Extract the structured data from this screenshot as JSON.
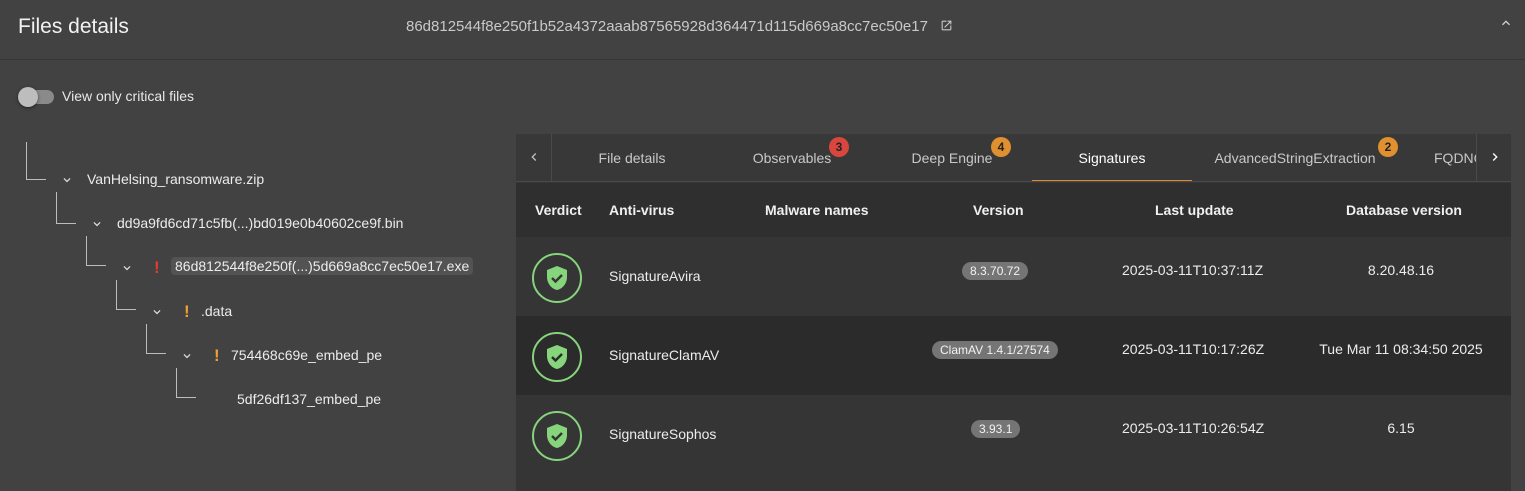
{
  "header": {
    "title": "Files details",
    "hash": "86d812544f8e250f1b52a4372aaab87565928d364471d115d669a8cc7ec50e17"
  },
  "toggle": {
    "label": "View only critical files",
    "checked": false
  },
  "tree": [
    {
      "name": "VanHelsing_ransomware.zip",
      "mark": ""
    },
    {
      "name": "dd9a9fd6cd71c5fb(...)bd019e0b40602ce9f.bin",
      "mark": ""
    },
    {
      "name": "86d812544f8e250f(...)5d669a8cc7ec50e17.exe",
      "mark": "!",
      "mark_color": "#e53935",
      "selected": true
    },
    {
      "name": ".data",
      "mark": "!",
      "mark_color": "#f0a030"
    },
    {
      "name": "754468c69e_embed_pe",
      "mark": "!",
      "mark_color": "#f0a030"
    },
    {
      "name": "5df26df137_embed_pe",
      "mark": ""
    }
  ],
  "tabs": [
    {
      "label": "File details"
    },
    {
      "label": "Observables",
      "badge": "3",
      "badge_color": "#d9463e"
    },
    {
      "label": "Deep Engine",
      "badge": "4",
      "badge_color": "#e0902e"
    },
    {
      "label": "Signatures",
      "active": true
    },
    {
      "label": "AdvancedStringExtraction",
      "badge": "2",
      "badge_color": "#e0902e"
    },
    {
      "label": "FQDNC"
    }
  ],
  "table": {
    "columns": [
      "Verdict",
      "Anti-virus",
      "Malware names",
      "Version",
      "Last update",
      "Database version"
    ],
    "rows": [
      {
        "verdict": "clean",
        "antivirus": "SignatureAvira",
        "malware": "",
        "version": "8.3.70.72",
        "last_update": "2025-03-11T10:37:11Z",
        "db_version": "8.20.48.16"
      },
      {
        "verdict": "clean",
        "antivirus": "SignatureClamAV",
        "malware": "",
        "version": "ClamAV 1.4.1/27574",
        "last_update": "2025-03-11T10:17:26Z",
        "db_version": "Tue Mar 11 08:34:50 2025"
      },
      {
        "verdict": "clean",
        "antivirus": "SignatureSophos",
        "malware": "",
        "version": "3.93.1",
        "last_update": "2025-03-11T10:26:54Z",
        "db_version": "6.15"
      }
    ]
  },
  "colors": {
    "accent": "#e0852e",
    "clean": "#86d47c"
  }
}
